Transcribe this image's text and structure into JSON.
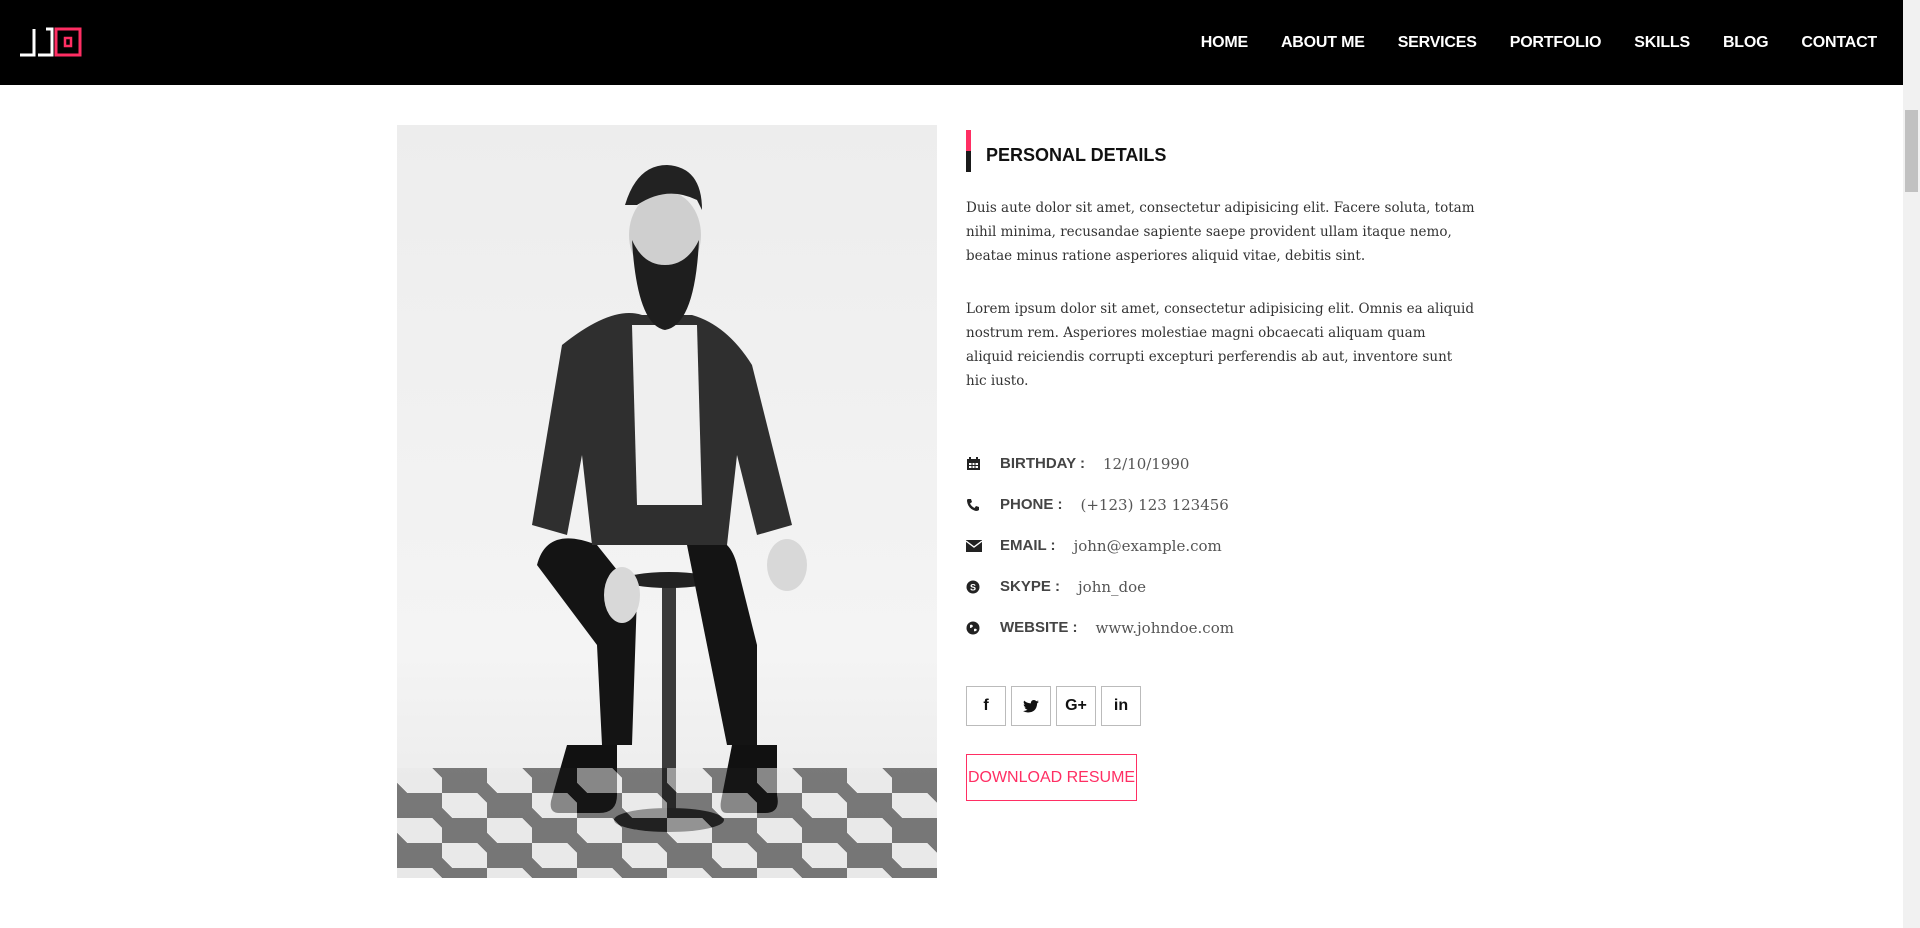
{
  "header": {
    "logo_alt": "JD",
    "nav": [
      "HOME",
      "ABOUT ME",
      "SERVICES",
      "PORTFOLIO",
      "SKILLS",
      "BLOG",
      "CONTACT"
    ]
  },
  "section": {
    "title": "PERSONAL DETAILS",
    "para1": "Duis aute dolor sit amet, consectetur adipisicing elit. Facere soluta, totam nihil minima, recusandae sapiente saepe provident ullam itaque nemo, beatae minus ratione asperiores aliquid vitae, debitis sint.",
    "para2": "Lorem ipsum dolor sit amet, consectetur adipisicing elit. Omnis ea aliquid nostrum rem. Asperiores molestiae magni obcaecati aliquam quam aliquid reiciendis corrupti excepturi perferendis ab aut, inventore sunt hic iusto.",
    "info": [
      {
        "icon": "calendar-icon",
        "label": "BIRTHDAY :",
        "value": "12/10/1990"
      },
      {
        "icon": "phone-icon",
        "label": "PHONE :",
        "value": "(+123) 123 123456"
      },
      {
        "icon": "envelope-icon",
        "label": "EMAIL :",
        "value": "john@example.com"
      },
      {
        "icon": "skype-icon",
        "label": "SKYPE :",
        "value": "john_doe"
      },
      {
        "icon": "globe-icon",
        "label": "WEBSITE :",
        "value": "www.johndoe.com"
      }
    ],
    "social": [
      {
        "icon": "facebook-icon",
        "glyph": "f"
      },
      {
        "icon": "twitter-icon",
        "glyph": "t"
      },
      {
        "icon": "google-plus-icon",
        "glyph": "G+"
      },
      {
        "icon": "linkedin-icon",
        "glyph": "in"
      }
    ],
    "download_label": "DOWNLOAD RESUME"
  },
  "colors": {
    "accent": "#ff2e63",
    "header_bg": "#000000"
  }
}
